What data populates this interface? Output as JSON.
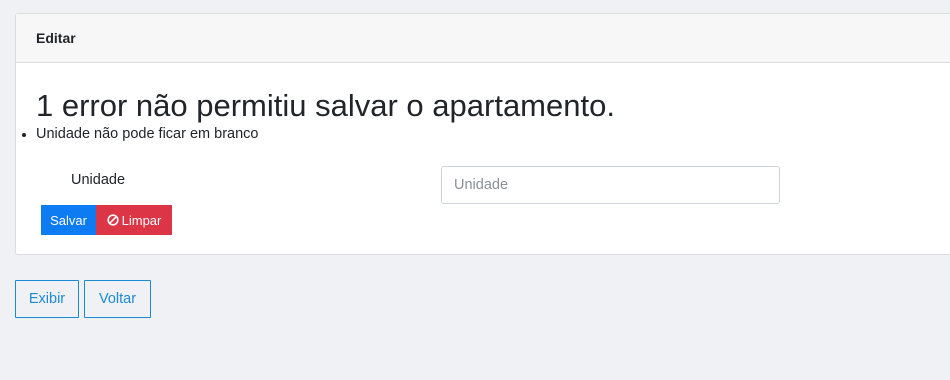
{
  "card": {
    "header_title": "Editar"
  },
  "errors": {
    "title": "1 error não permitiu salvar o apartamento.",
    "items": [
      "Unidade não pode ficar em branco"
    ]
  },
  "form": {
    "unidade_label": "Unidade",
    "unidade_placeholder": "Unidade",
    "unidade_value": "",
    "save_label": "Salvar",
    "clear_label": "Limpar",
    "clear_icon": "ban-icon"
  },
  "actions": {
    "show_label": "Exibir",
    "back_label": "Voltar"
  },
  "colors": {
    "primary": "#0d7cf2",
    "danger": "#dc3545",
    "outline": "#1b8ad6",
    "background": "#f0f1f5"
  }
}
